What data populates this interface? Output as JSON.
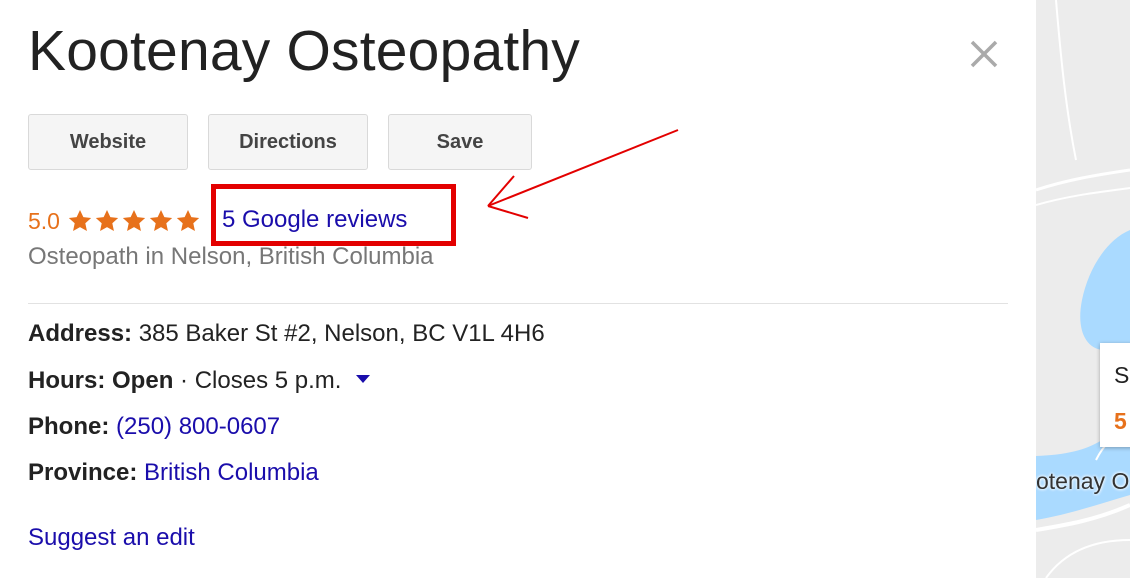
{
  "business": {
    "name": "Kootenay Osteopathy",
    "category": "Osteopath in Nelson, British Columbia"
  },
  "actions": {
    "website": "Website",
    "directions": "Directions",
    "save": "Save"
  },
  "rating": {
    "value": "5.0",
    "stars": 5,
    "reviews_link": "5 Google reviews",
    "accent_color": "#e7711b"
  },
  "details": {
    "address_label": "Address:",
    "address_value": "385 Baker St #2, Nelson, BC V1L 4H6",
    "hours_label": "Hours:",
    "hours_status": "Open",
    "hours_separator": "·",
    "hours_detail": "Closes 5 p.m.",
    "phone_label": "Phone:",
    "phone_value": "(250) 800-0607",
    "province_label": "Province:",
    "province_value": "British Columbia"
  },
  "suggest_edit": "Suggest an edit",
  "map": {
    "card_line1": "S",
    "card_line2": "5",
    "place_label": "otenay O"
  },
  "colors": {
    "link": "#1a0dab",
    "annotation": "#e30000",
    "water": "#aadaff"
  },
  "icons": {
    "close": "close-icon",
    "star": "star-icon",
    "caret": "caret-down-icon"
  }
}
